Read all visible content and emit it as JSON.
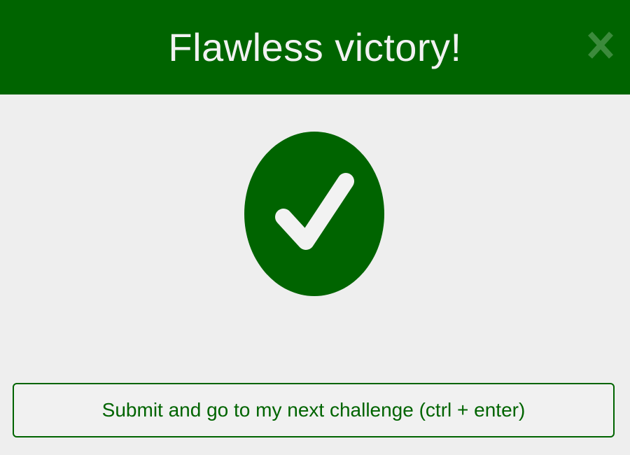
{
  "dialog": {
    "title": "Flawless victory!",
    "close_icon": "close-x-icon",
    "result_icon": "checkmark-circle-icon",
    "submit_label": "Submit and go to my next challenge (ctrl + enter)"
  },
  "colors": {
    "accent": "#006400",
    "background": "#eeeeee",
    "title_text": "#f2f2f2",
    "close_icon": "#3c8a3c"
  }
}
